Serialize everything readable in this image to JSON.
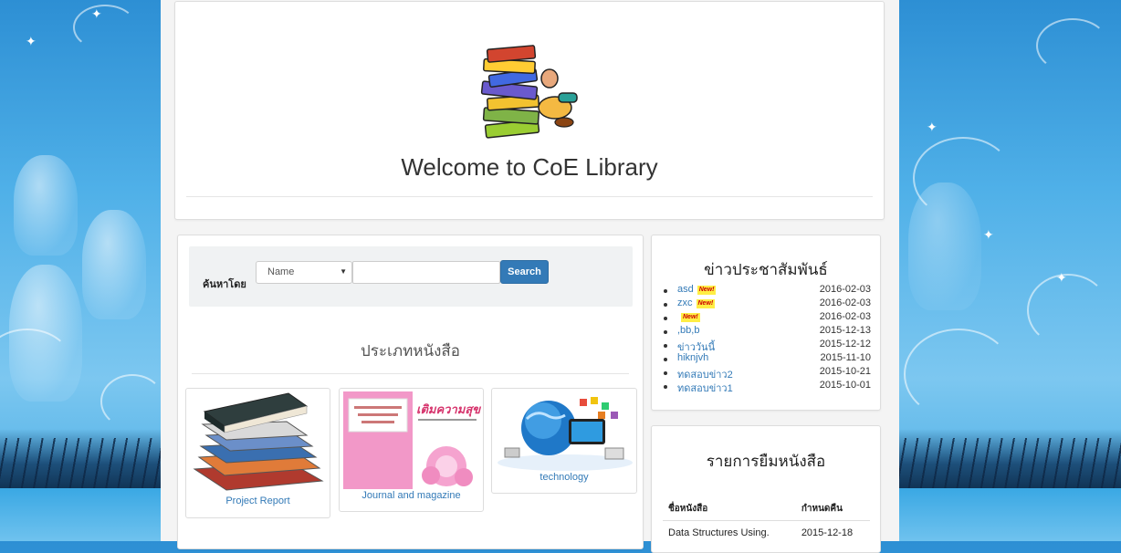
{
  "header": {
    "title": "Welcome to CoE Library",
    "logo_icon": "stacked-books-logo"
  },
  "search": {
    "label": "ค้นหาโดย",
    "select_value": "Name",
    "input_value": "",
    "button_label": "Search"
  },
  "categories": {
    "title": "ประเภทหนังสือ",
    "items": [
      {
        "label": "Project Report",
        "image": "book-stack-image"
      },
      {
        "label": "Journal and magazine",
        "image": "magazine-cover-image"
      },
      {
        "label": "technology",
        "image": "technology-globe-image"
      }
    ],
    "magazine_cover_title": "เติมความสุข"
  },
  "news": {
    "title": "ข่าวประชาสัมพันธ์",
    "new_badge": "New!",
    "items": [
      {
        "label": "asd",
        "date": "2016-02-03",
        "is_new": true
      },
      {
        "label": "zxc",
        "date": "2016-02-03",
        "is_new": true
      },
      {
        "label": "",
        "date": "2016-02-03",
        "is_new": true
      },
      {
        "label": ",bb,b",
        "date": "2015-12-13",
        "is_new": false
      },
      {
        "label": "ข่าววันนี้",
        "date": "2015-12-12",
        "is_new": false
      },
      {
        "label": "hiknjvh",
        "date": "2015-11-10",
        "is_new": false
      },
      {
        "label": "ทดสอบข่าว2",
        "date": "2015-10-21",
        "is_new": false
      },
      {
        "label": "ทดสอบข่าว1",
        "date": "2015-10-01",
        "is_new": false
      }
    ]
  },
  "borrow": {
    "title": "รายการยืมหนังสือ",
    "columns": [
      "ชื่อหนังสือ",
      "กำหนดคืน"
    ],
    "rows": [
      [
        "Data Structures Using.",
        "2015-12-18"
      ]
    ]
  },
  "colors": {
    "link": "#337ab7",
    "primary_button": "#337ab7",
    "page_background": "#f4f4f4",
    "sky_blue": "#4fb0e8",
    "new_badge": "#ffee44"
  }
}
